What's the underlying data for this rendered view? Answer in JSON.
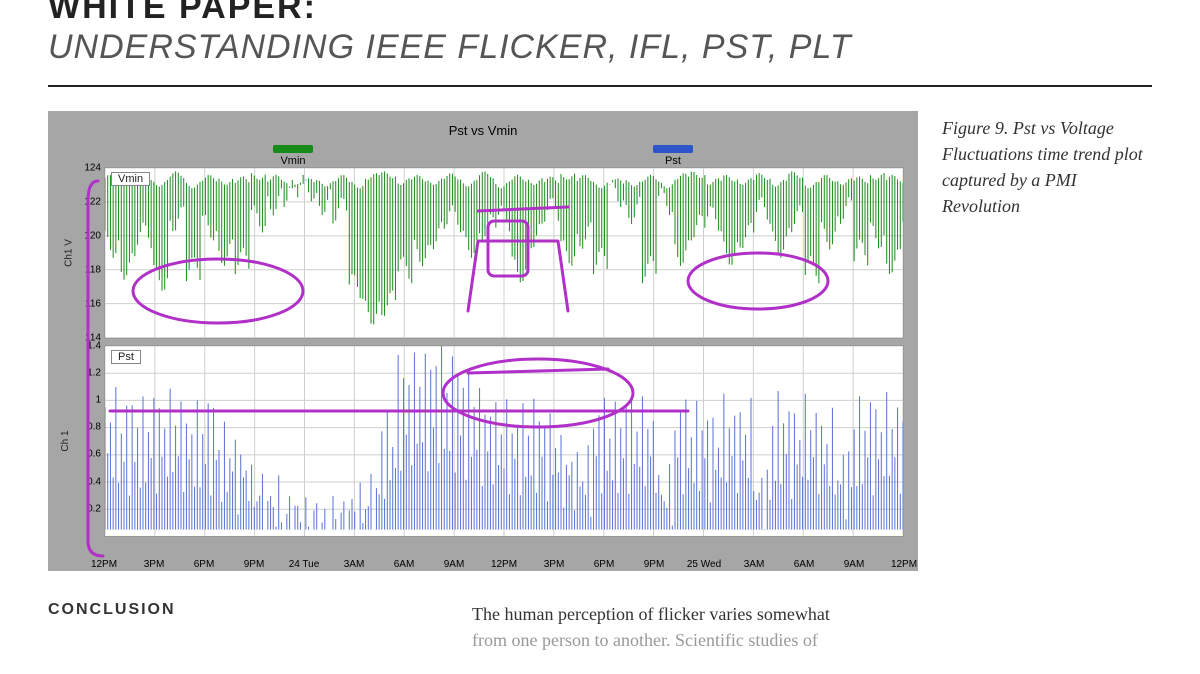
{
  "header": {
    "pretitle": "WHITE PAPER:",
    "subtitle": "UNDERSTANDING IEEE FLICKER, IFL, PST, PLT"
  },
  "figure": {
    "caption": "Figure 9. Pst vs Voltage Fluctuations time trend plot captured by a PMI Revolution",
    "chart_title": "Pst vs Vmin",
    "legend": {
      "vmin": "Vmin",
      "pst": "Pst"
    },
    "series_label_top": "Vmin",
    "series_label_bot": "Pst",
    "yaxis_title_top": "Ch1 V",
    "yaxis_title_bot": "Ch 1"
  },
  "conclusion_heading": "CONCLUSION",
  "body": {
    "line1": "The human perception of flicker varies somewhat",
    "line2_cut": "from one person to another. Scientific studies of"
  },
  "chart_data": [
    {
      "type": "line",
      "name": "Vmin",
      "ylabel": "Ch1 V",
      "ylim": [
        114,
        124
      ],
      "yticks": [
        114,
        116,
        118,
        120,
        122,
        124
      ],
      "x_labels": [
        "12PM",
        "3PM",
        "6PM",
        "9PM",
        "24 Tue",
        "3AM",
        "6AM",
        "9AM",
        "12PM",
        "3PM",
        "6PM",
        "9PM",
        "25 Wed",
        "3AM",
        "6AM",
        "9AM",
        "12PM"
      ],
      "x_index": [
        0,
        1,
        2,
        3,
        4,
        5,
        6,
        7,
        8,
        9,
        10,
        11,
        12,
        13,
        14,
        15,
        16,
        17,
        18,
        19,
        20,
        21,
        22,
        23,
        24,
        25,
        26,
        27,
        28,
        29,
        30,
        31,
        32,
        33,
        34,
        35,
        36,
        37,
        38,
        39,
        40,
        41,
        42,
        43,
        44,
        45,
        46,
        47,
        48,
        49
      ],
      "values_high": [
        123.4,
        123.2,
        123.5,
        123.1,
        123.6,
        123.0,
        123.4,
        123.2,
        123.3,
        123.5,
        123.4,
        123.0,
        123.2,
        123.1,
        123.4,
        123.0,
        123.5,
        123.6,
        123.2,
        123.4,
        123.2,
        123.5,
        123.1,
        123.6,
        123.0,
        123.4,
        123.2,
        123.3,
        123.5,
        123.4,
        123.0,
        123.2,
        123.1,
        123.4,
        123.0,
        123.5,
        123.6,
        123.2,
        123.4,
        123.2,
        123.5,
        123.1,
        123.6,
        123.0,
        123.4,
        123.2,
        123.3,
        123.5,
        123.4,
        123.0
      ],
      "values_low": [
        119.5,
        118.2,
        120.0,
        117.5,
        121.0,
        118.0,
        120.5,
        119.0,
        118.5,
        121.0,
        122.0,
        122.5,
        122.8,
        122.0,
        121.5,
        117.0,
        115.5,
        116.0,
        118.0,
        119.0,
        120.0,
        121.0,
        119.5,
        120.5,
        121.0,
        118.0,
        120.0,
        121.5,
        119.0,
        120.0,
        118.5,
        122.5,
        121.5,
        118.0,
        122.0,
        119.0,
        120.5,
        121.0,
        119.0,
        120.0,
        121.5,
        119.5,
        121.0,
        118.0,
        120.0,
        121.5,
        119.0,
        120.0,
        118.5,
        121.5
      ]
    },
    {
      "type": "line",
      "name": "Pst",
      "ylabel": "Ch 1",
      "ylim": [
        0,
        1.4
      ],
      "yticks": [
        0.2,
        0.4,
        0.6,
        0.8,
        1.0,
        1.2,
        1.4
      ],
      "x_labels": [
        "12PM",
        "3PM",
        "6PM",
        "9PM",
        "24 Tue",
        "3AM",
        "6AM",
        "9AM",
        "12PM",
        "3PM",
        "6PM",
        "9PM",
        "25 Wed",
        "3AM",
        "6AM",
        "9AM",
        "12PM"
      ],
      "x_index": [
        0,
        1,
        2,
        3,
        4,
        5,
        6,
        7,
        8,
        9,
        10,
        11,
        12,
        13,
        14,
        15,
        16,
        17,
        18,
        19,
        20,
        21,
        22,
        23,
        24,
        25,
        26,
        27,
        28,
        29,
        30,
        31,
        32,
        33,
        34,
        35,
        36,
        37,
        38,
        39,
        40,
        41,
        42,
        43,
        44,
        45,
        46,
        47,
        48,
        49
      ],
      "values": [
        0.95,
        0.9,
        0.88,
        0.92,
        0.95,
        0.85,
        0.9,
        0.7,
        0.6,
        0.4,
        0.3,
        0.2,
        0.15,
        0.12,
        0.18,
        0.25,
        0.35,
        0.8,
        1.2,
        1.25,
        1.3,
        1.2,
        1.1,
        0.95,
        0.9,
        0.85,
        0.88,
        0.8,
        0.6,
        0.55,
        0.9,
        0.85,
        0.92,
        0.88,
        0.4,
        0.9,
        0.85,
        0.8,
        0.9,
        0.88,
        0.4,
        0.92,
        0.85,
        0.9,
        0.8,
        0.55,
        0.88,
        0.9,
        0.92,
        0.85
      ],
      "threshold_line": 1.0
    }
  ]
}
